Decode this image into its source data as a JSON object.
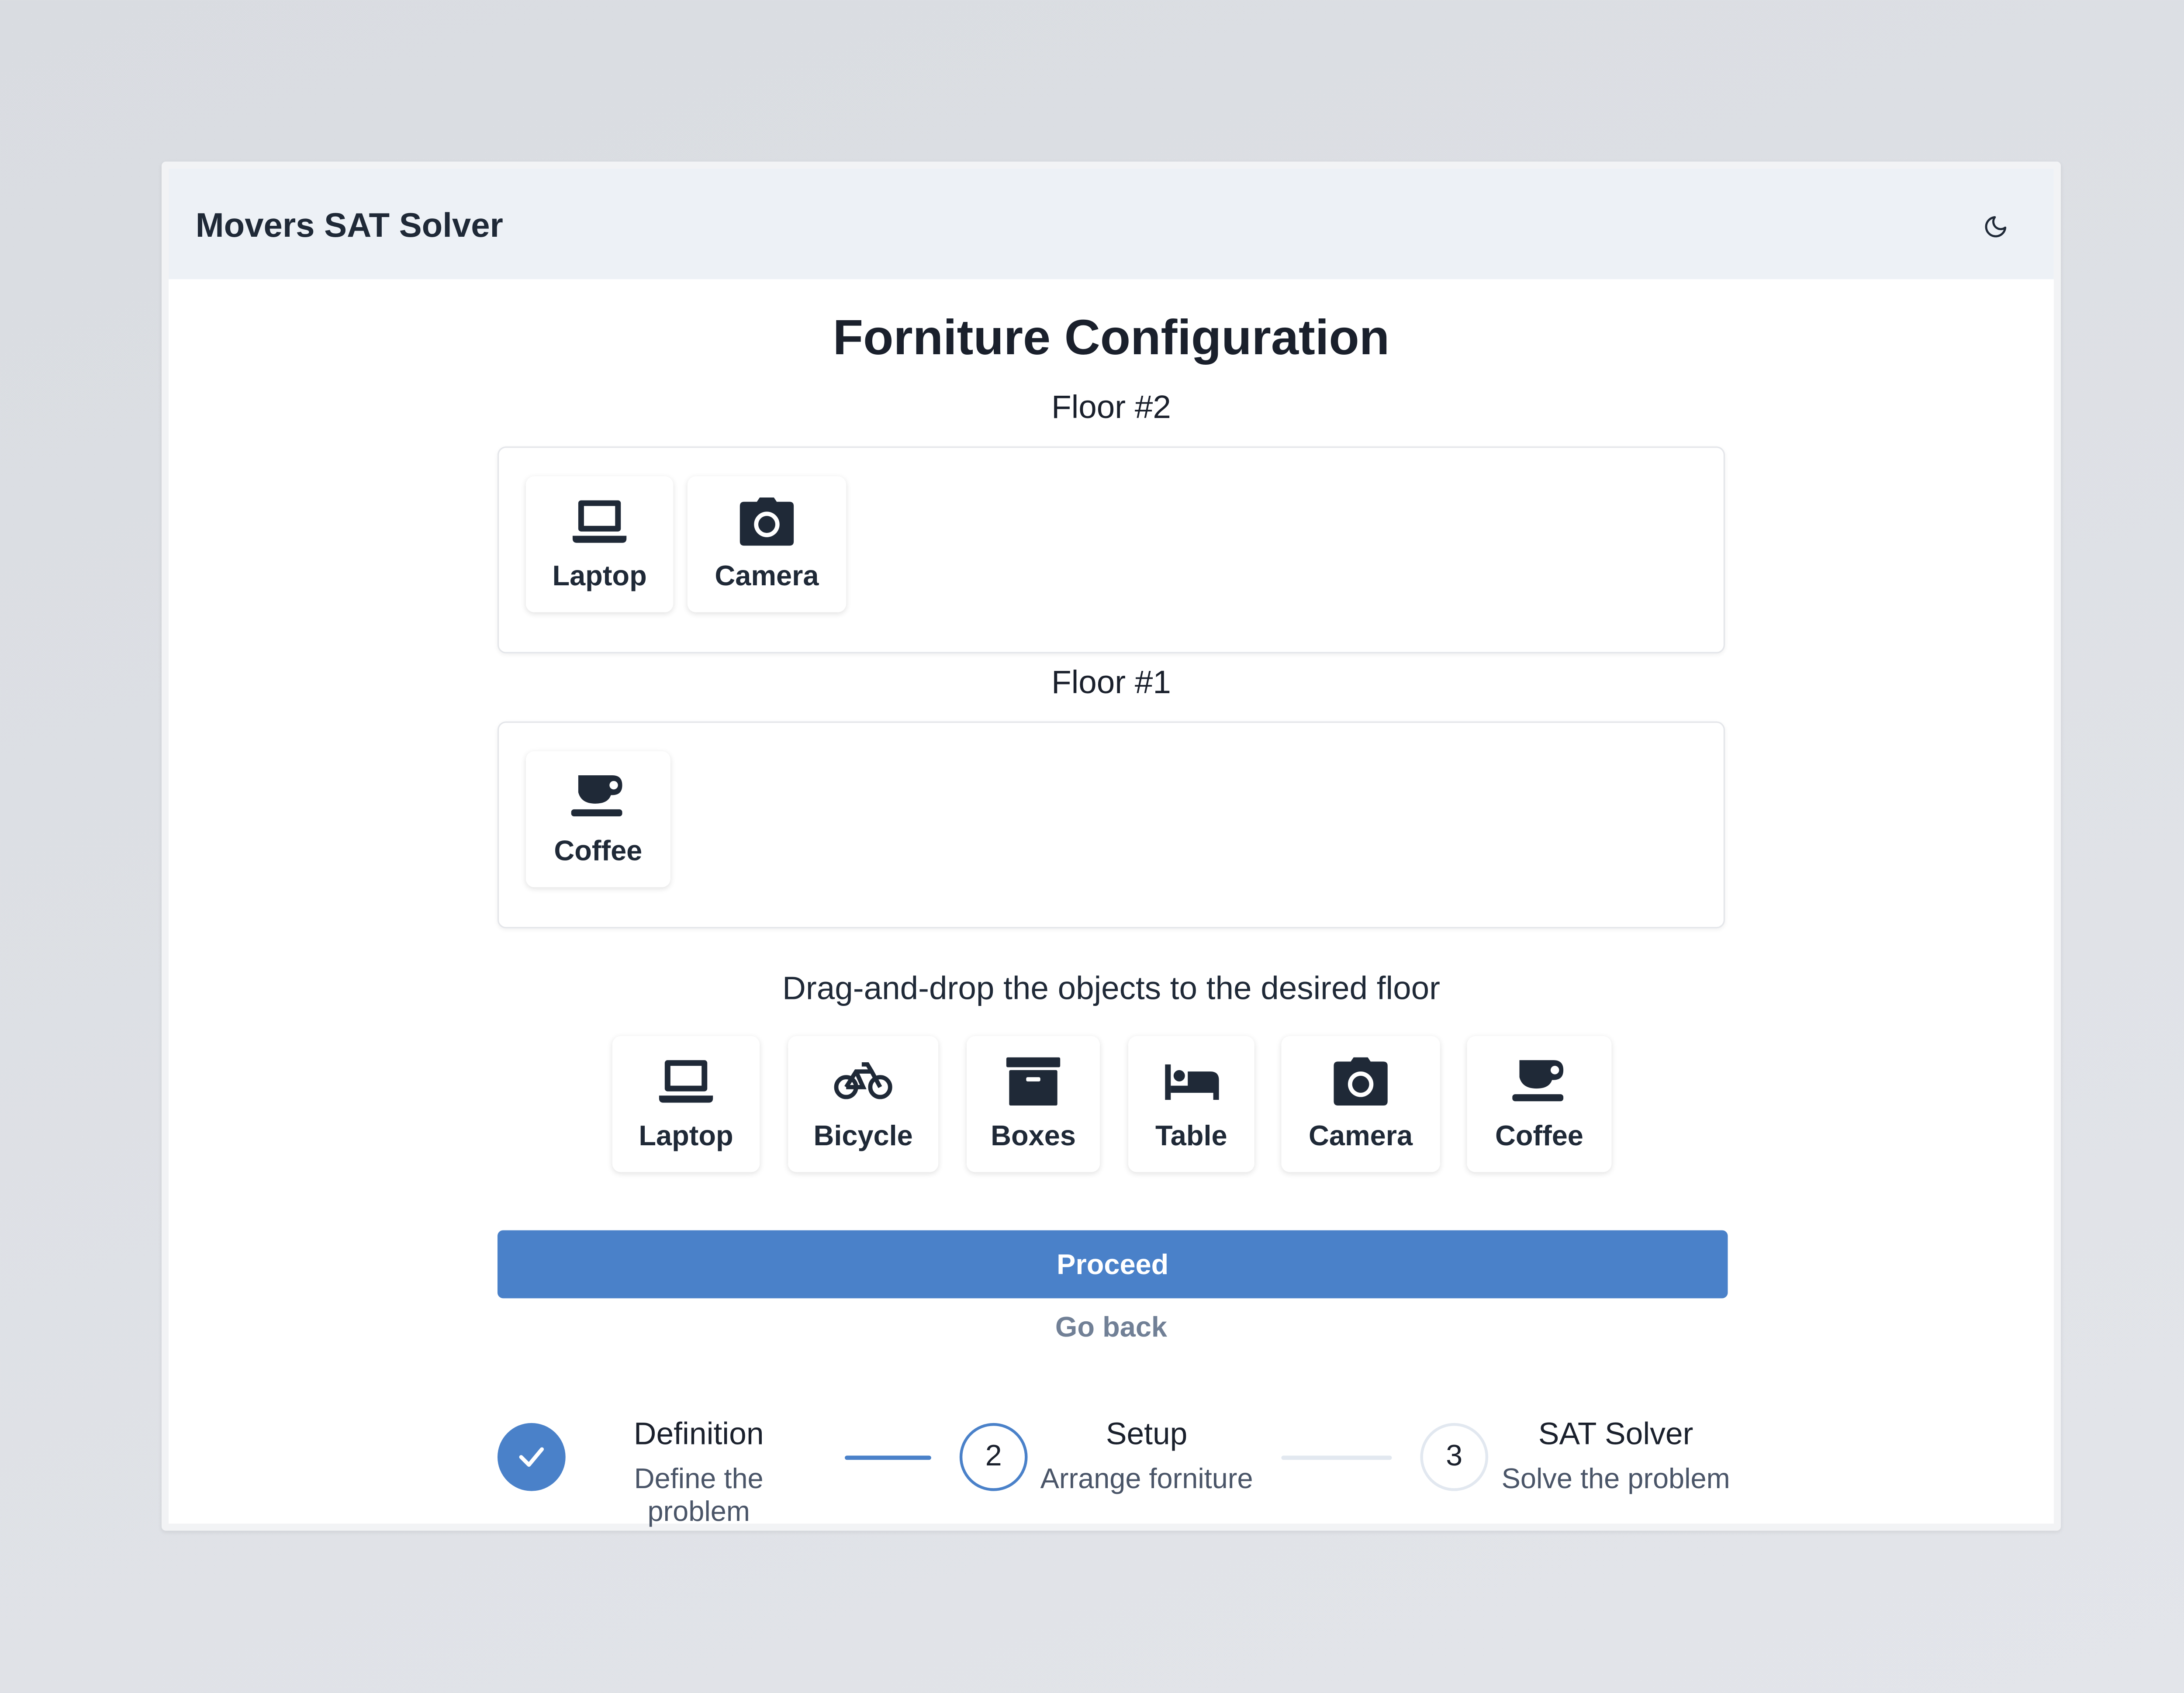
{
  "app": {
    "title": "Movers SAT Solver",
    "theme_toggle_icon": "moon-icon"
  },
  "page": {
    "title": "Forniture Configuration",
    "hint": "Drag-and-drop the objects to the desired floor"
  },
  "floors": [
    {
      "label": "Floor #2",
      "items": [
        {
          "label": "Laptop",
          "icon": "laptop-icon"
        },
        {
          "label": "Camera",
          "icon": "camera-icon"
        }
      ]
    },
    {
      "label": "Floor #1",
      "items": [
        {
          "label": "Coffee",
          "icon": "coffee-icon"
        }
      ]
    }
  ],
  "palette": [
    {
      "label": "Laptop",
      "icon": "laptop-icon"
    },
    {
      "label": "Bicycle",
      "icon": "bicycle-icon"
    },
    {
      "label": "Boxes",
      "icon": "boxes-icon"
    },
    {
      "label": "Table",
      "icon": "bed-icon"
    },
    {
      "label": "Camera",
      "icon": "camera-icon"
    },
    {
      "label": "Coffee",
      "icon": "coffee-icon"
    }
  ],
  "actions": {
    "proceed_label": "Proceed",
    "back_label": "Go back"
  },
  "stepper": [
    {
      "number": "1",
      "title": "Definition",
      "description": "Define the problem",
      "state": "completed"
    },
    {
      "number": "2",
      "title": "Setup",
      "description": "Arrange forniture",
      "state": "active"
    },
    {
      "number": "3",
      "title": "SAT Solver",
      "description": "Solve the problem",
      "state": "pending"
    }
  ],
  "colors": {
    "accent": "#4a81c9",
    "header_bg": "#edf1f6",
    "muted_text": "#718096"
  }
}
